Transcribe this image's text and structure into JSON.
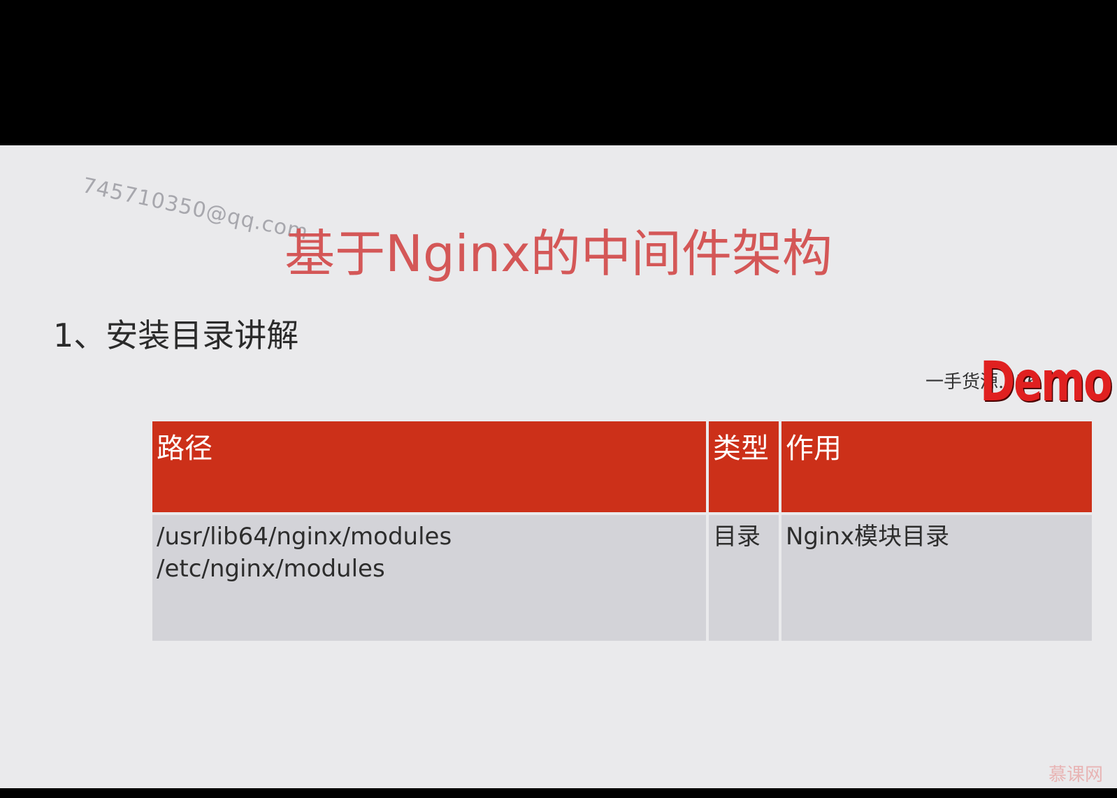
{
  "slide": {
    "email_watermark": "745710350@qq.com",
    "title": "基于Nginx的中间件架构",
    "section_heading": "1、安装目录讲解",
    "seller_watermark": "一手货源...56",
    "demo_stamp": "Demo",
    "brand_logo": "慕课网"
  },
  "table": {
    "headers": {
      "path": "路径",
      "type": "类型",
      "desc": "作用"
    },
    "rows": [
      {
        "paths": [
          "/usr/lib64/nginx/modules",
          "/etc/nginx/modules"
        ],
        "type": "目录",
        "desc": "Nginx模块目录"
      }
    ]
  },
  "colors": {
    "title": "#d45757",
    "header_bg": "#cc3019",
    "body_bg": "#d3d3d8",
    "slide_bg": "#eaeaec"
  }
}
